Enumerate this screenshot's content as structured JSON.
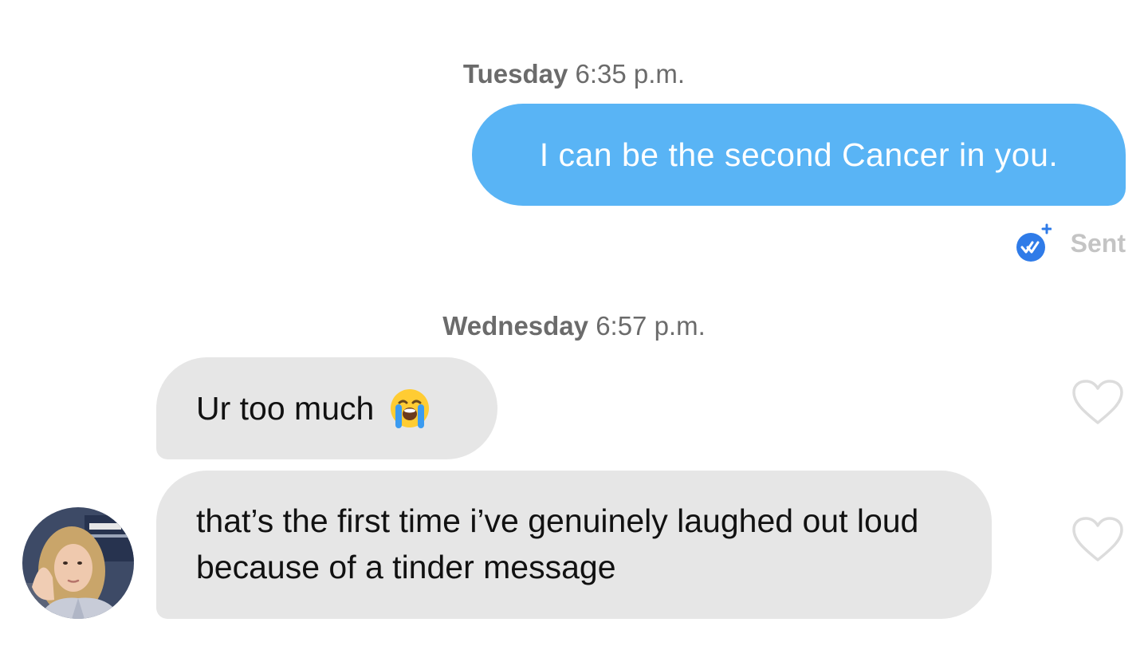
{
  "conversation": {
    "timestamps": [
      {
        "day": "Tuesday",
        "time": "6:35 p.m."
      },
      {
        "day": "Wednesday",
        "time": "6:57 p.m."
      }
    ],
    "outgoing": {
      "text": "I can be the second Cancer in you.",
      "status": "Sent",
      "status_icon": "double-check-icon"
    },
    "incoming": [
      {
        "text": "Ur too much",
        "emoji": "loudly-crying-face-emoji"
      },
      {
        "text": "that’s the first time i’ve genuinely laughed out loud because of a tinder message"
      }
    ]
  },
  "colors": {
    "outgoing_bubble": "#59b4f5",
    "incoming_bubble": "#e6e6e6",
    "timestamp_text": "#6b6b6b",
    "status_text": "#c4c4c4",
    "status_icon": "#2f7be8",
    "heart_outline": "#dcdcdc"
  }
}
